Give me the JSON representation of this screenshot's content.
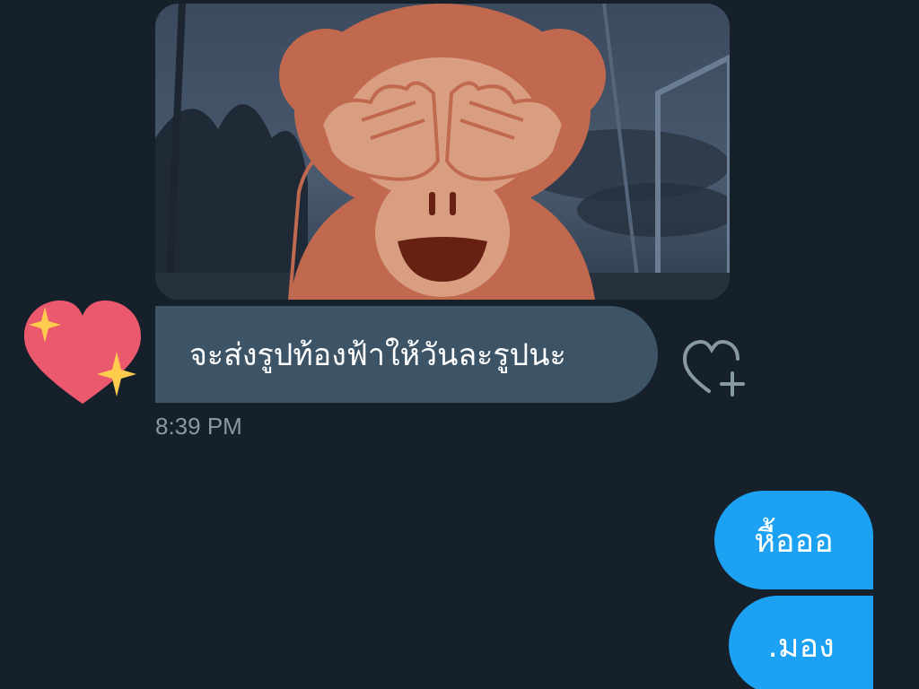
{
  "conversation": {
    "incoming": {
      "image_sticker_icon": "see-no-evil-monkey-icon",
      "text": "จะส่งรูปท้องฟ้าให้วันละรูปนะ",
      "reaction_icon": "sparkling-heart-icon",
      "like_icon": "heart-plus-icon",
      "timestamp": "8:39 PM"
    },
    "outgoing": [
      {
        "text": "หื้อออ"
      },
      {
        "text": ".มอง"
      }
    ]
  },
  "colors": {
    "background": "#15202b",
    "incoming_bubble": "#3d5466",
    "outgoing_bubble": "#1da1f2",
    "timestamp": "#8899a6"
  }
}
